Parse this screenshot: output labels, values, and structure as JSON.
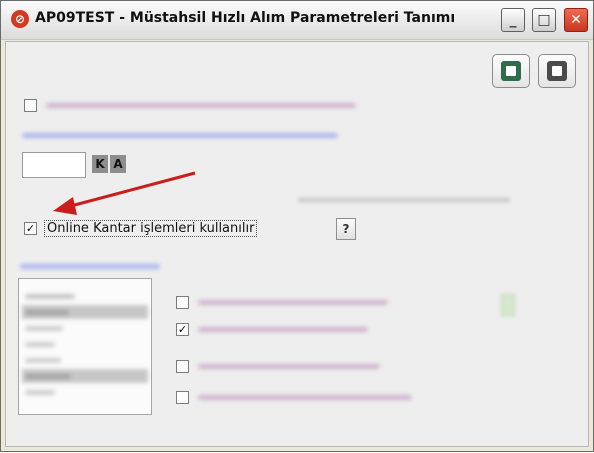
{
  "window": {
    "title": "AP09TEST - Müstahsil Hızlı Alım Parametreleri Tanımı",
    "app_icon": "app-logo-icon",
    "buttons": {
      "minimize_glyph": "_",
      "maximize_glyph": "□",
      "close_glyph": "✕"
    }
  },
  "toolbar": {
    "save_icon": "save-icon",
    "exit_icon": "exit-icon"
  },
  "form": {
    "ka_buttons": [
      "K",
      "A"
    ],
    "kantar": {
      "checked": true,
      "check_glyph": "✓",
      "label": "Online Kantar işlemleri kullanılır"
    },
    "help_button_label": "?",
    "options": [
      {
        "checked": false
      },
      {
        "checked": true,
        "check_glyph": "✓"
      },
      {
        "checked": false
      },
      {
        "checked": false
      }
    ]
  },
  "colors": {
    "blurred_label": "#c7a3c4",
    "blurred_blue": "#9aa5f0",
    "arrow": "#cc1d1d"
  }
}
